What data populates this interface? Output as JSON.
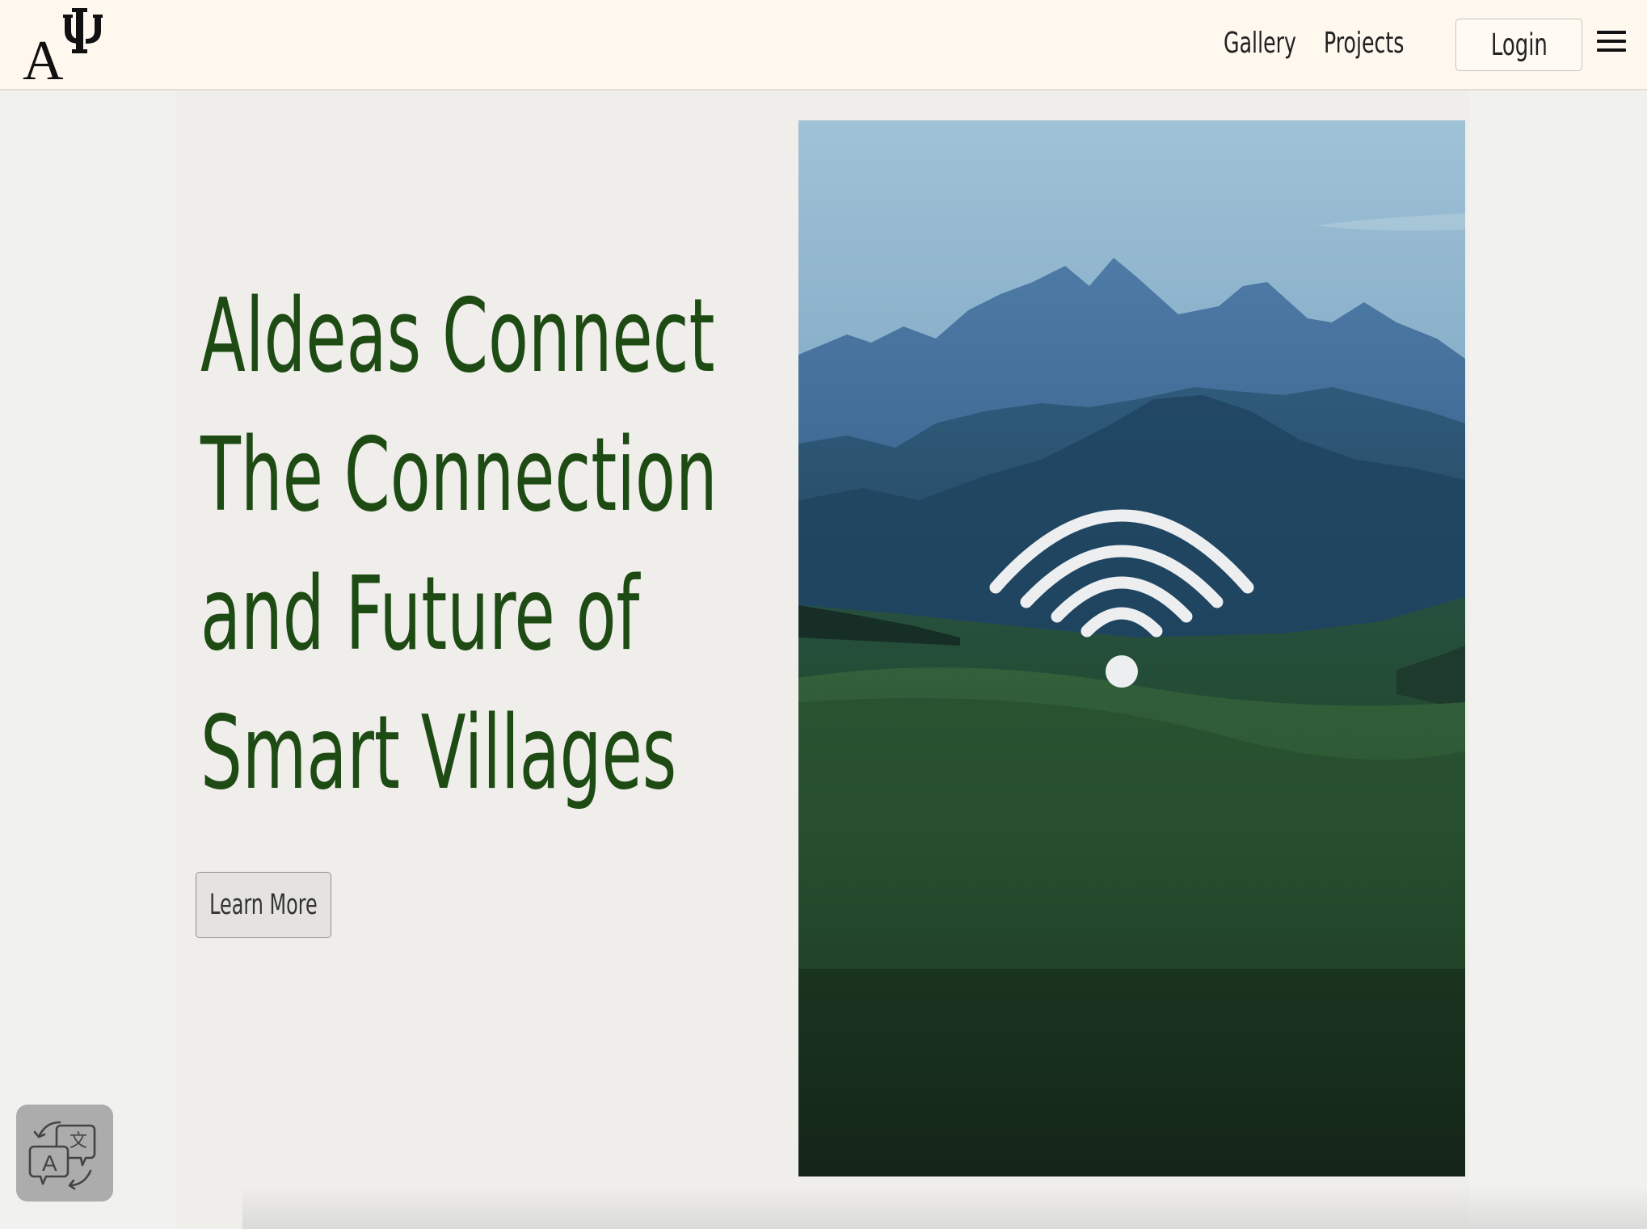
{
  "header": {
    "logo_alt": "AΨ",
    "nav": [
      {
        "label": "Gallery"
      },
      {
        "label": "Projects"
      }
    ],
    "login_label": "Login"
  },
  "hero": {
    "title_lines": [
      "Aldeas Connect",
      "The Connection",
      "and Future of",
      "Smart Villages"
    ],
    "cta_label": "Learn More",
    "image_icon": "wifi-icon"
  },
  "widgets": {
    "translate_icon": "translate-icon"
  },
  "colors": {
    "header_bg": "#fff8ee",
    "title_green": "#1e4a14",
    "page_bg": "#f1f1f0"
  }
}
